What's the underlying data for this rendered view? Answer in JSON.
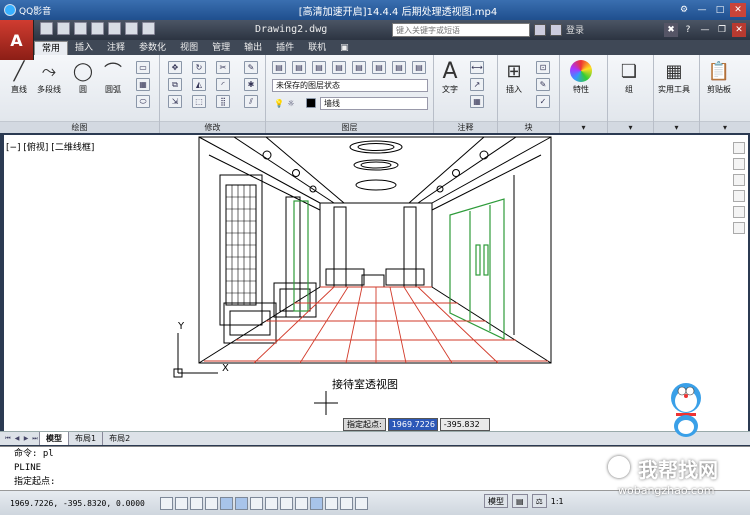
{
  "player": {
    "app_name": "QQ影音",
    "title": "[高清加速开启]14.4.4  后期处理透视图.mp4"
  },
  "cad": {
    "app_button": "A",
    "doc_title": "Drawing2.dwg",
    "search_placeholder": "键入关键字或短语",
    "login_label": "登录"
  },
  "ribbon_tabs": [
    "常用",
    "插入",
    "注释",
    "参数化",
    "视图",
    "管理",
    "输出",
    "插件",
    "联机"
  ],
  "panels": {
    "draw": {
      "title": "绘图",
      "tools": [
        "直线",
        "多段线",
        "圆",
        "圆弧"
      ]
    },
    "modify": {
      "title": "修改"
    },
    "layers": {
      "title": "图层",
      "state_value": "未保存的图层状态",
      "layer_value": "墙线"
    },
    "annotation": {
      "title": "注释",
      "text_label": "文字"
    },
    "block": {
      "title": "块",
      "insert_label": "插入"
    },
    "properties": {
      "label": "特性"
    },
    "groups": {
      "label": "组"
    },
    "utilities": {
      "label": "实用工具"
    },
    "clipboard": {
      "label": "剪贴板"
    }
  },
  "viewport": {
    "view_label": "[−] [俯视] [二维线框]",
    "drawing_caption": "接待室透视图",
    "ucs_x": "X",
    "ucs_y": "Y"
  },
  "dynamic_input": {
    "label": "指定起点:",
    "x_value": "1969.7226",
    "y_value": "-395.832"
  },
  "layout_tabs": [
    "模型",
    "布局1",
    "布局2"
  ],
  "command_history": [
    "命令: pl",
    "PLINE",
    "指定起点:"
  ],
  "status": {
    "coordinates": "1969.7226, -395.8320, 0.0000",
    "model_label": "模型",
    "scale_label": "1:1"
  },
  "watermark": {
    "cn": "我帮找网",
    "en": "wobangzhao.com"
  },
  "colors": {
    "floor_grid": "#d23a2a",
    "door_frame": "#2e9b3a",
    "highlight_input": "#2c58b8"
  }
}
